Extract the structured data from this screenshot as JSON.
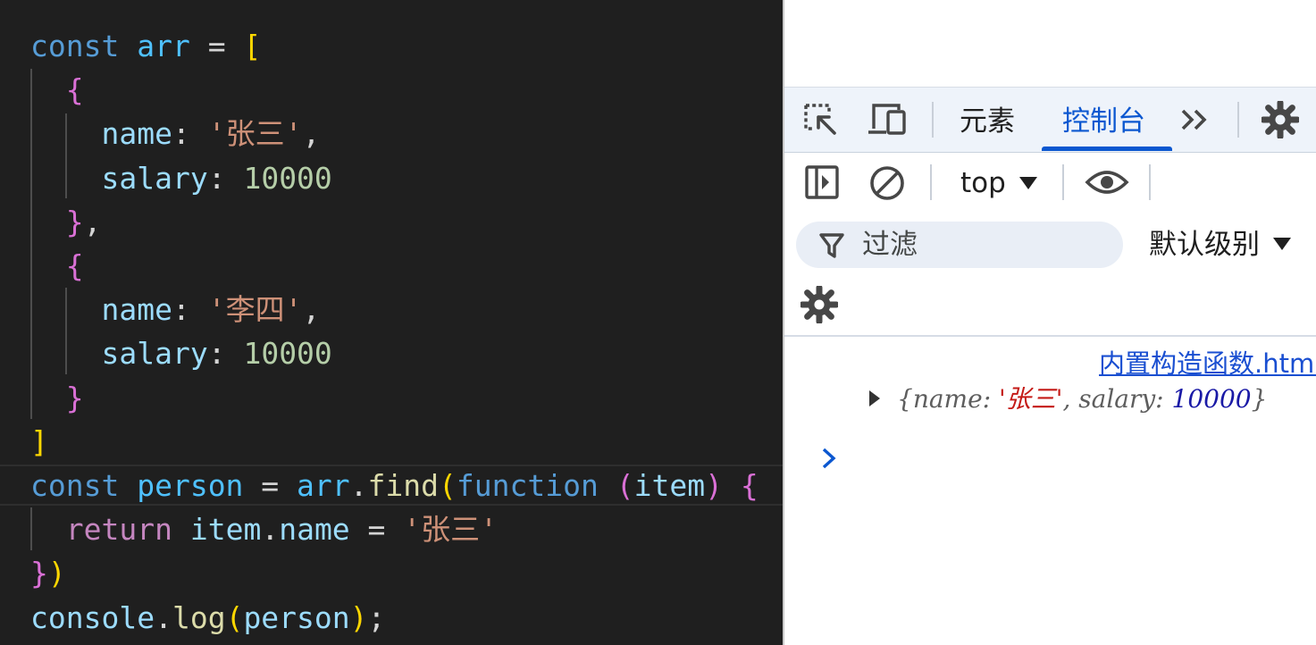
{
  "editor": {
    "lines": [
      [
        [
          "kw",
          "const"
        ],
        [
          "pu",
          " "
        ],
        [
          "vr",
          "arr"
        ],
        [
          "pu",
          " = "
        ],
        [
          "b1",
          "["
        ]
      ],
      [
        [
          "pu",
          "  "
        ],
        [
          "b2",
          "{"
        ]
      ],
      [
        [
          "pu",
          "    "
        ],
        [
          "pr",
          "name"
        ],
        [
          "pu",
          ": "
        ],
        [
          "st",
          "'张三'"
        ],
        [
          "pu",
          ","
        ]
      ],
      [
        [
          "pu",
          "    "
        ],
        [
          "pr",
          "salary"
        ],
        [
          "pu",
          ": "
        ],
        [
          "nu",
          "10000"
        ]
      ],
      [
        [
          "pu",
          "  "
        ],
        [
          "b2",
          "}"
        ],
        [
          "pu",
          ","
        ]
      ],
      [
        [
          "pu",
          "  "
        ],
        [
          "b2",
          "{"
        ]
      ],
      [
        [
          "pu",
          "    "
        ],
        [
          "pr",
          "name"
        ],
        [
          "pu",
          ": "
        ],
        [
          "st",
          "'李四'"
        ],
        [
          "pu",
          ","
        ]
      ],
      [
        [
          "pu",
          "    "
        ],
        [
          "pr",
          "salary"
        ],
        [
          "pu",
          ": "
        ],
        [
          "nu",
          "10000"
        ]
      ],
      [
        [
          "pu",
          "  "
        ],
        [
          "b2",
          "}"
        ]
      ],
      [
        [
          "b1",
          "]"
        ]
      ],
      [
        [
          "kw",
          "const"
        ],
        [
          "pu",
          " "
        ],
        [
          "vr",
          "person"
        ],
        [
          "pu",
          " = "
        ],
        [
          "vr",
          "arr"
        ],
        [
          "pu",
          "."
        ],
        [
          "fn",
          "find"
        ],
        [
          "b1",
          "("
        ],
        [
          "kw",
          "function"
        ],
        [
          "pu",
          " "
        ],
        [
          "b2",
          "("
        ],
        [
          "pr",
          "item"
        ],
        [
          "b2",
          ")"
        ],
        [
          "pu",
          " "
        ],
        [
          "b2",
          "{"
        ]
      ],
      [
        [
          "pu",
          "  "
        ],
        [
          "ct",
          "return"
        ],
        [
          "pu",
          " "
        ],
        [
          "pr",
          "item"
        ],
        [
          "pu",
          "."
        ],
        [
          "pr",
          "name"
        ],
        [
          "pu",
          " = "
        ],
        [
          "st",
          "'张三'"
        ]
      ],
      [
        [
          "b2",
          "}"
        ],
        [
          "b1",
          ")"
        ]
      ],
      [
        [
          "pr",
          "console"
        ],
        [
          "pu",
          "."
        ],
        [
          "fn",
          "log"
        ],
        [
          "b1",
          "("
        ],
        [
          "pr",
          "person"
        ],
        [
          "b1",
          ")"
        ],
        [
          "pu",
          ";"
        ]
      ]
    ]
  },
  "devtools": {
    "tabs": {
      "elements": "元素",
      "console": "控制台"
    },
    "context": "top",
    "filter_placeholder": "过滤",
    "log_level": "默认级别",
    "source_link": "内置构造函数.html",
    "log": {
      "open": "{",
      "key1": "name",
      "val1": "'张三'",
      "key2": "salary",
      "val2": "10000",
      "close": "}"
    }
  },
  "colors": {
    "accent": "#0b57d0",
    "editor_bg": "#1f1f1f",
    "keyword": "#569cd6",
    "string": "#ce9178",
    "number": "#b5cea8"
  }
}
